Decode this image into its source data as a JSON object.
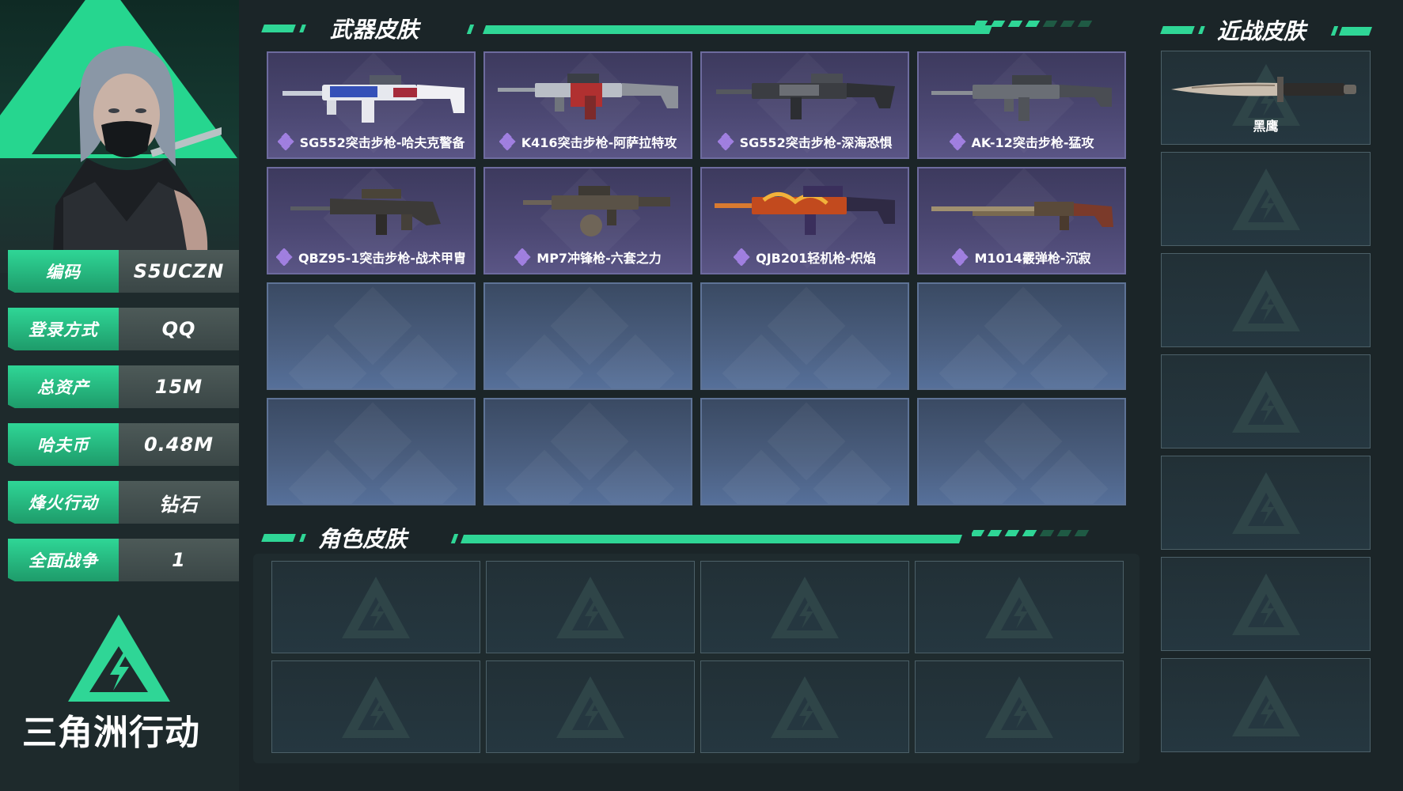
{
  "profile": {
    "fields": [
      {
        "key": "编码",
        "value": "S5UCZN"
      },
      {
        "key": "登录方式",
        "value": "QQ"
      },
      {
        "key": "总资产",
        "value": "15M"
      },
      {
        "key": "哈夫币",
        "value": "0.48M"
      },
      {
        "key": "烽火行动",
        "value": "钻石"
      },
      {
        "key": "全面战争",
        "value": "1"
      }
    ],
    "brand_name": "三角洲行动"
  },
  "sections": {
    "weapons_title": "武器皮肤",
    "characters_title": "角色皮肤",
    "melee_title": "近战皮肤"
  },
  "weapons": [
    {
      "name": "SG552突击步枪-哈夫克警备",
      "icon": "rifle-white-blue-icon"
    },
    {
      "name": "K416突击步枪-阿萨拉特攻",
      "icon": "rifle-silver-red-icon"
    },
    {
      "name": "SG552突击步枪-深海恐惧",
      "icon": "rifle-dark-camo-icon"
    },
    {
      "name": "AK-12突击步枪-猛攻",
      "icon": "rifle-grey-camo-icon"
    },
    {
      "name": "QBZ95-1突击步枪-战术甲胄",
      "icon": "bullpup-rifle-icon"
    },
    {
      "name": "MP7冲锋枪-六套之力",
      "icon": "smg-drum-icon"
    },
    {
      "name": "QJB201轻机枪-炽焰",
      "icon": "lmg-flame-icon"
    },
    {
      "name": "M1014霰弹枪-沉寂",
      "icon": "shotgun-icon"
    }
  ],
  "melee": [
    {
      "name": "黑鹰",
      "icon": "combat-knife-icon"
    }
  ],
  "colors": {
    "accent": "#2fd696",
    "weapon_card": "#4c4873",
    "empty_card": "#4b5f80",
    "background": "#1b2528"
  }
}
